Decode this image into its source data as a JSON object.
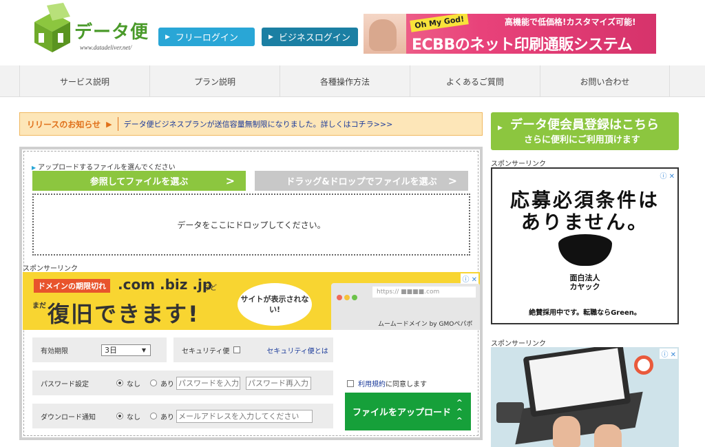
{
  "header": {
    "logo_text": "データ便",
    "logo_url": "www.datadeliver.net/",
    "free_login": "フリーログイン",
    "biz_login": "ビジネスログイン"
  },
  "top_banner": {
    "tag": "Oh My God!",
    "headline": "高機能で低価格!カスタマイズ可能!",
    "main": "ECBBのネット印刷通販システム"
  },
  "nav": [
    "サービス説明",
    "プラン説明",
    "各種操作方法",
    "よくあるご質問",
    "お問い合わせ"
  ],
  "notice": {
    "label": "リリースのお知らせ",
    "text": "データ便ビジネスプランが送信容量無制限になりました。詳しくはコチラ>>>"
  },
  "upload": {
    "select_label": "アップロードするファイルを選んでください",
    "browse_btn": "参照してファイルを選ぶ",
    "drag_btn": "ドラッグ&ドロップでファイルを選ぶ",
    "drop_text": "データをここにドロップしてください。"
  },
  "sponsor_label": "スポンサーリンク",
  "ad1": {
    "tag": "ドメインの期限切れ",
    "domains": ".com .biz .jp",
    "nado": "など",
    "mada": "まだ",
    "main": "復旧できます!",
    "bubble": "サイトが表示されない!",
    "url": "https:// ■■■■.com",
    "brand": "ムームードメイン by GMOペパボ"
  },
  "options": {
    "expiry_label": "有効期限",
    "expiry_value": "3日",
    "security_label": "セキュリティ便",
    "security_link": "セキュリティ便とは",
    "password_label": "パスワード設定",
    "download_label": "ダウンロード通知",
    "radio_none": "なし",
    "radio_yes": "あり",
    "password_placeholder": "パスワードを入力",
    "password_confirm_placeholder": "パスワード再入力",
    "email_placeholder": "メールアドレスを入力してください"
  },
  "agree": {
    "terms_link": "利用規約",
    "text": "に同意します"
  },
  "upload_btn": "ファイルをアップロード",
  "side": {
    "reg_line1": "データ便会員登録はこちら",
    "reg_line2": "さらに便利にご利用頂けます"
  },
  "ad2": {
    "line1": "応募必須条件は",
    "line2": "ありません。",
    "company1": "面白法人",
    "company2": "カヤック",
    "footer": "絶賛採用中です。転職ならGreen。"
  },
  "colors": {
    "green": "#8cc63f",
    "blue": "#29a6d6",
    "dark_blue": "#1b7fa3",
    "upload_green": "#16a03a"
  }
}
